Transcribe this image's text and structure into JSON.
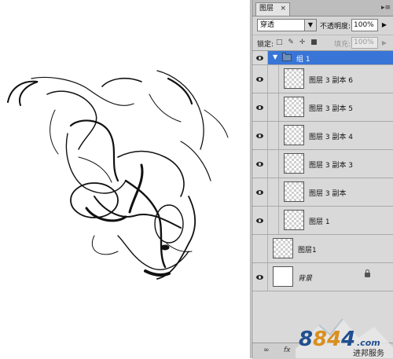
{
  "panel": {
    "tab_label": "图层",
    "close_glyph": "×",
    "menu_glyph": "▸≡",
    "blend_mode": "穿透",
    "opacity_label": "不透明度:",
    "opacity_value": "100%",
    "lock_label": "锁定:",
    "lock_icons": "□ ✎ ✛ ■",
    "fill_label": "填充:",
    "fill_value": "100%"
  },
  "layers": [
    {
      "name": "组 1",
      "type": "group",
      "visible": true,
      "selected": true
    },
    {
      "name": "图层 3 副本 6",
      "type": "layer",
      "visible": true,
      "indented": true
    },
    {
      "name": "图层 3 副本 5",
      "type": "layer",
      "visible": true,
      "indented": true
    },
    {
      "name": "图层 3 副本 4",
      "type": "layer",
      "visible": true,
      "indented": true
    },
    {
      "name": "图层 3 副本 3",
      "type": "layer",
      "visible": true,
      "indented": true
    },
    {
      "name": "图层 3 副本",
      "type": "layer",
      "visible": true,
      "indented": true
    },
    {
      "name": "图层 1",
      "type": "layer",
      "visible": true,
      "indented": true
    },
    {
      "name": "图层1",
      "type": "layer",
      "visible": false,
      "indented": false
    },
    {
      "name": "背景",
      "type": "background",
      "visible": true,
      "indented": false,
      "locked": true
    }
  ],
  "bottom_icons": [
    "link-icon",
    "fx-icon"
  ],
  "watermark": {
    "logo_text": "8844.com",
    "caption": "进邦服务"
  },
  "colors": {
    "selection": "#3875d7",
    "panel_bg": "#d9d9d9"
  }
}
